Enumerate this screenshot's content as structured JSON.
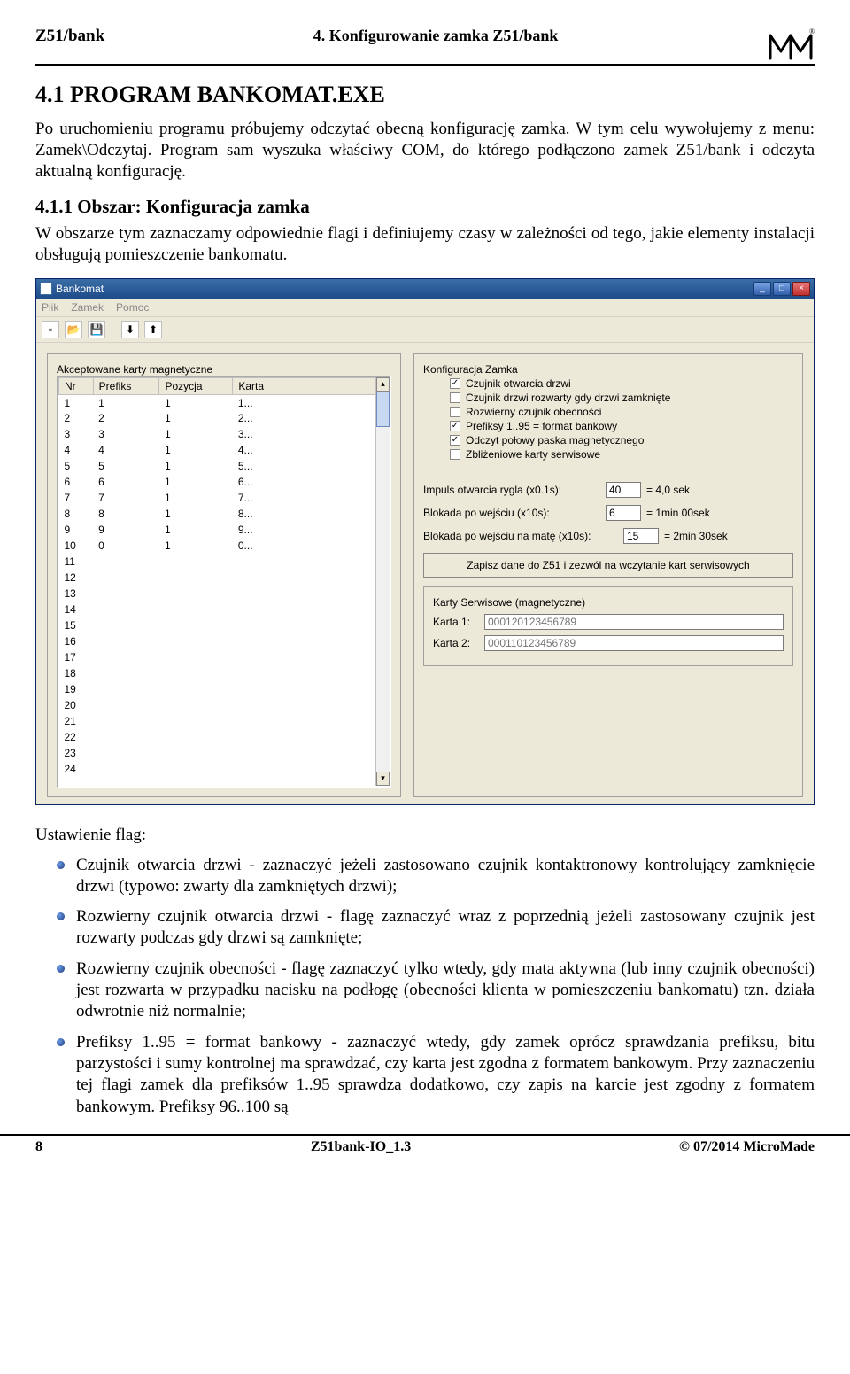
{
  "header": {
    "left": "Z51/bank",
    "center": "4. Konfigurowanie zamka Z51/bank"
  },
  "section41": {
    "title": "4.1 PROGRAM BANKOMAT.EXE",
    "para": "Po uruchomieniu programu próbujemy odczytać obecną konfigurację zamka. W tym celu wywołujemy z menu: Zamek\\Odczytaj. Program sam wyszuka właściwy COM, do którego podłączono zamek Z51/bank i odczyta aktualną konfigurację."
  },
  "section411": {
    "title": "4.1.1 Obszar: Konfiguracja zamka",
    "para": "W obszarze tym zaznaczamy odpowiednie flagi i definiujemy czasy w zależności od tego, jakie elementy instalacji obsługują pomieszczenie bankomatu."
  },
  "app": {
    "title": "Bankomat",
    "menu": [
      "Plik",
      "Zamek",
      "Pomoc"
    ],
    "groupCards": "Akceptowane karty magnetyczne",
    "columns": [
      "Nr",
      "Prefiks",
      "Pozycja",
      "Karta"
    ],
    "rows": [
      {
        "nr": "1",
        "prefiks": "1",
        "pozycja": "1",
        "karta": "1..."
      },
      {
        "nr": "2",
        "prefiks": "2",
        "pozycja": "1",
        "karta": "2..."
      },
      {
        "nr": "3",
        "prefiks": "3",
        "pozycja": "1",
        "karta": "3..."
      },
      {
        "nr": "4",
        "prefiks": "4",
        "pozycja": "1",
        "karta": "4..."
      },
      {
        "nr": "5",
        "prefiks": "5",
        "pozycja": "1",
        "karta": "5..."
      },
      {
        "nr": "6",
        "prefiks": "6",
        "pozycja": "1",
        "karta": "6..."
      },
      {
        "nr": "7",
        "prefiks": "7",
        "pozycja": "1",
        "karta": "7..."
      },
      {
        "nr": "8",
        "prefiks": "8",
        "pozycja": "1",
        "karta": "8..."
      },
      {
        "nr": "9",
        "prefiks": "9",
        "pozycja": "1",
        "karta": "9..."
      },
      {
        "nr": "10",
        "prefiks": "0",
        "pozycja": "1",
        "karta": "0..."
      },
      {
        "nr": "11",
        "prefiks": "",
        "pozycja": "",
        "karta": ""
      },
      {
        "nr": "12",
        "prefiks": "",
        "pozycja": "",
        "karta": ""
      },
      {
        "nr": "13",
        "prefiks": "",
        "pozycja": "",
        "karta": ""
      },
      {
        "nr": "14",
        "prefiks": "",
        "pozycja": "",
        "karta": ""
      },
      {
        "nr": "15",
        "prefiks": "",
        "pozycja": "",
        "karta": ""
      },
      {
        "nr": "16",
        "prefiks": "",
        "pozycja": "",
        "karta": ""
      },
      {
        "nr": "17",
        "prefiks": "",
        "pozycja": "",
        "karta": ""
      },
      {
        "nr": "18",
        "prefiks": "",
        "pozycja": "",
        "karta": ""
      },
      {
        "nr": "19",
        "prefiks": "",
        "pozycja": "",
        "karta": ""
      },
      {
        "nr": "20",
        "prefiks": "",
        "pozycja": "",
        "karta": ""
      },
      {
        "nr": "21",
        "prefiks": "",
        "pozycja": "",
        "karta": ""
      },
      {
        "nr": "22",
        "prefiks": "",
        "pozycja": "",
        "karta": ""
      },
      {
        "nr": "23",
        "prefiks": "",
        "pozycja": "",
        "karta": ""
      },
      {
        "nr": "24",
        "prefiks": "",
        "pozycja": "",
        "karta": ""
      }
    ],
    "groupConfig": "Konfiguracja Zamka",
    "checks": [
      {
        "label": "Czujnik otwarcia drzwi",
        "checked": true
      },
      {
        "label": "Czujnik drzwi rozwarty gdy drzwi zamknięte",
        "checked": false
      },
      {
        "label": "Rozwierny czujnik obecności",
        "checked": false
      },
      {
        "label": "Prefiksy 1..95 = format bankowy",
        "checked": true
      },
      {
        "label": "Odczyt połowy paska magnetycznego",
        "checked": true
      },
      {
        "label": "Zbliżeniowe karty serwisowe",
        "checked": false
      }
    ],
    "impuls": {
      "label": "Impuls otwarcia rygla (x0.1s):",
      "value": "40",
      "suffix": "= 4,0 sek"
    },
    "blokadaW": {
      "label": "Blokada po wejściu (x10s):",
      "value": "6",
      "suffix": "= 1min 00sek"
    },
    "blokadaM": {
      "label": "Blokada po wejściu na matę (x10s):",
      "value": "15",
      "suffix": "= 2min 30sek"
    },
    "saveBtn": "Zapisz dane do Z51 i zezwól na wczytanie kart serwisowych",
    "groupService": "Karty Serwisowe (magnetyczne)",
    "karta1": {
      "label": "Karta 1:",
      "placeholder": "000120123456789"
    },
    "karta2": {
      "label": "Karta 2:",
      "placeholder": "000110123456789"
    }
  },
  "flags": {
    "heading": "Ustawienie flag:",
    "items": [
      "Czujnik otwarcia drzwi - zaznaczyć jeżeli zastosowano czujnik kontaktronowy kontrolujący zamknięcie drzwi (typowo:  zwarty dla zamkniętych drzwi);",
      "Rozwierny czujnik otwarcia drzwi - flagę zaznaczyć wraz z poprzednią jeżeli zastosowany czujnik jest rozwarty podczas gdy drzwi są zamknięte;",
      "Rozwierny czujnik obecności - flagę zaznaczyć tylko wtedy, gdy mata aktywna (lub inny czujnik obecności) jest rozwarta w przypadku nacisku na podłogę (obecności klienta w pomieszczeniu bankomatu) tzn. działa odwrotnie niż normalnie;",
      "Prefiksy 1..95 = format bankowy - zaznaczyć wtedy, gdy zamek oprócz sprawdzania prefiksu, bitu parzystości i sumy kontrolnej ma sprawdzać, czy karta jest zgodna z formatem bankowym. Przy zaznaczeniu tej flagi zamek dla prefiksów 1..95 sprawdza dodatkowo, czy zapis na karcie jest zgodny z formatem bankowym. Prefiksy 96..100 są"
    ]
  },
  "footer": {
    "left": "8",
    "center": "Z51bank-IO_1.3",
    "right": "© 07/2014 MicroMade"
  }
}
